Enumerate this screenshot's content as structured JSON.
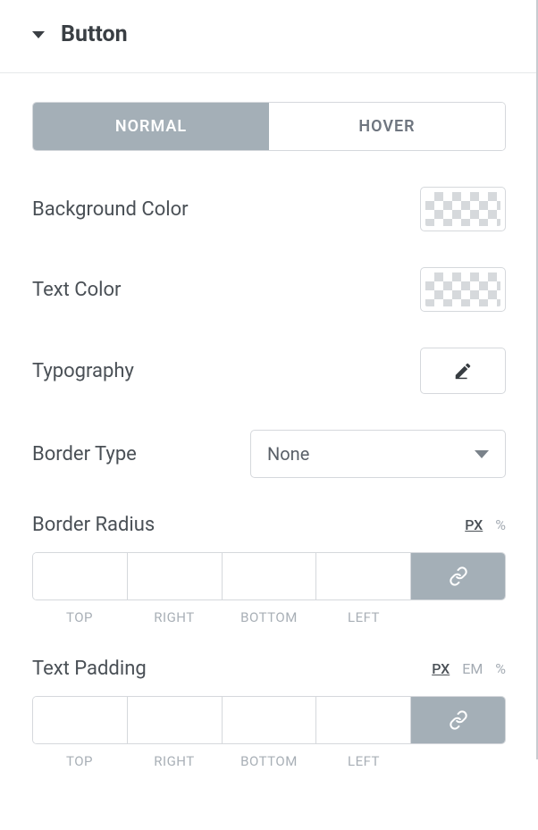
{
  "panel": {
    "title": "Button"
  },
  "tabs": {
    "normal": "NORMAL",
    "hover": "HOVER"
  },
  "controls": {
    "bg_color_label": "Background Color",
    "text_color_label": "Text Color",
    "typography_label": "Typography",
    "border_type_label": "Border Type",
    "border_type_value": "None",
    "border_radius_label": "Border Radius",
    "text_padding_label": "Text Padding"
  },
  "units": {
    "px": "PX",
    "em": "EM",
    "pct": "%"
  },
  "sides": {
    "top": "TOP",
    "right": "RIGHT",
    "bottom": "BOTTOM",
    "left": "LEFT"
  }
}
